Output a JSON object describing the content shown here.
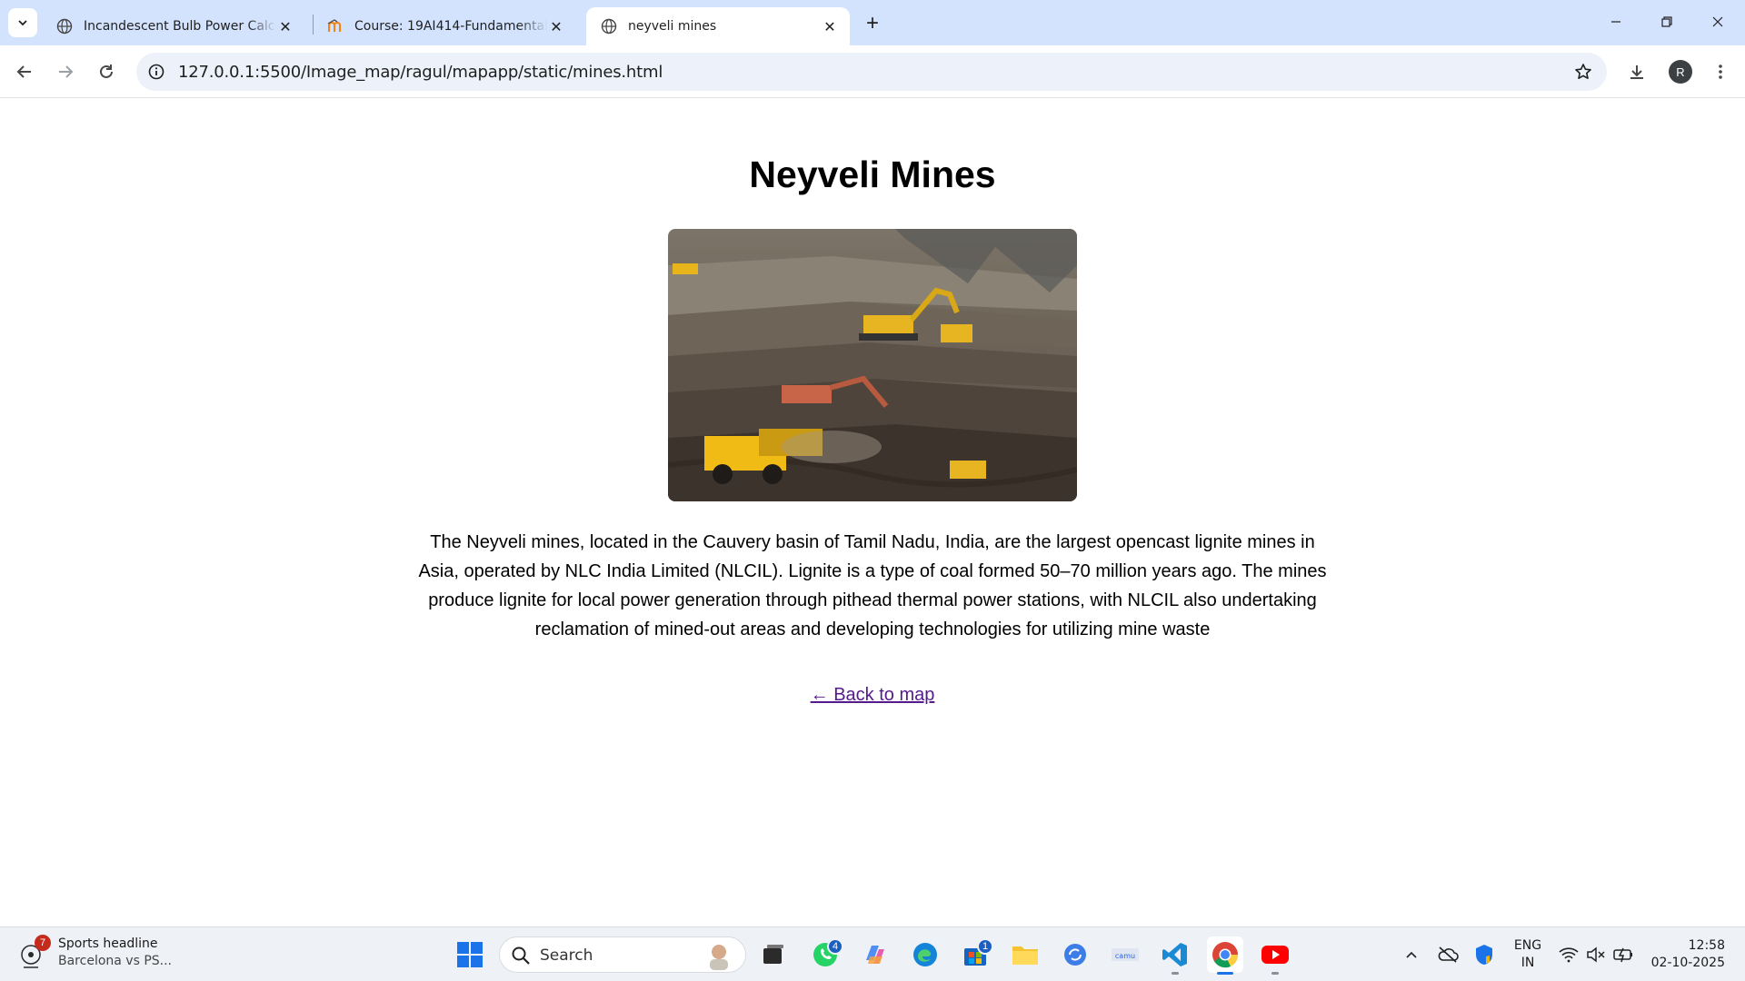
{
  "browser": {
    "tabs": [
      {
        "title": "Incandescent Bulb Power Calculator",
        "favicon": "globe-icon",
        "active": false
      },
      {
        "title": "Course: 19AI414-Fundamentals",
        "favicon": "moodle-icon",
        "active": false
      },
      {
        "title": "neyveli mines",
        "favicon": "globe-icon",
        "active": true
      }
    ],
    "url": "127.0.0.1:5500/Image_map/ragul/mapapp/static/mines.html",
    "profile_initial": "R"
  },
  "page": {
    "title": "Neyveli Mines",
    "description": "The Neyveli mines, located in the Cauvery basin of Tamil Nadu, India, are the largest opencast lignite mines in Asia, operated by NLC India Limited (NLCIL). Lignite is a type of coal formed 50–70 million years ago. The mines produce lignite for local power generation through pithead thermal power stations, with NLCIL also undertaking reclamation of mined-out areas and developing technologies for utilizing mine waste",
    "back_link": "← Back to map",
    "link_color": "#551a8b"
  },
  "taskbar": {
    "widget": {
      "badge": "7",
      "title": "Sports headline",
      "subtitle": "Barcelona vs PS..."
    },
    "search_label": "Search",
    "whatsapp_badge": "4",
    "store_badge": "1",
    "language": {
      "line1": "ENG",
      "line2": "IN"
    },
    "clock": {
      "time": "12:58",
      "date": "02-10-2025"
    }
  }
}
